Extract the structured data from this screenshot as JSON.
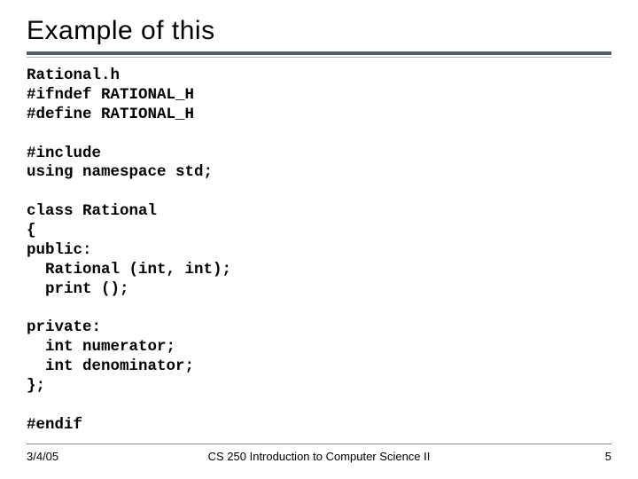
{
  "title": "Example of this",
  "code": "Rational.h\n#ifndef RATIONAL_H\n#define RATIONAL_H\n\n#include\nusing namespace std;\n\nclass Rational\n{\npublic:\n  Rational (int, int);\n  print ();\n\nprivate:\n  int numerator;\n  int denominator;\n};\n\n#endif",
  "footer": {
    "date": "3/4/05",
    "course": "CS 250 Introduction to Computer Science II",
    "page": "5"
  }
}
